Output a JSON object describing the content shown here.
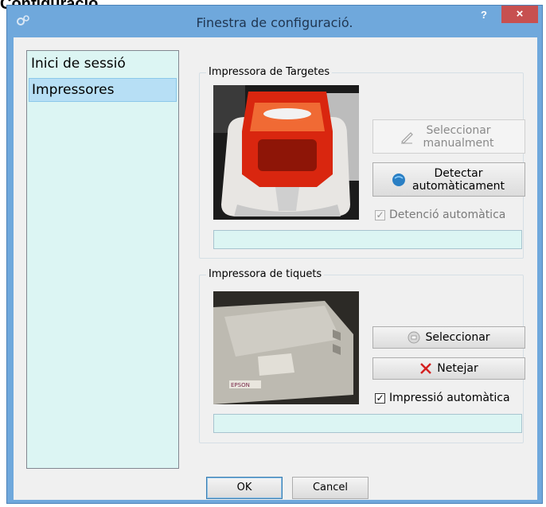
{
  "background_heading": "Configuració",
  "window": {
    "title": "Finestra de configuració.",
    "help_label": "?",
    "close_label": "×"
  },
  "sidebar": {
    "items": [
      {
        "label": "Inici de sessió",
        "selected": false
      },
      {
        "label": "Impressores",
        "selected": true
      }
    ]
  },
  "card_printer": {
    "legend": "Impressora de Targetes",
    "select_manual_label": "Seleccionar manualment",
    "select_manual_enabled": false,
    "detect_label": "Detectar automàticament",
    "auto_detect_label": "Detenció automàtica",
    "auto_detect_checked": true,
    "auto_detect_enabled": false,
    "status_value": ""
  },
  "ticket_printer": {
    "legend": "Impressora de tiquets",
    "select_label": "Seleccionar",
    "clear_label": "Netejar",
    "auto_print_label": "Impressió automàtica",
    "auto_print_checked": true,
    "status_value": ""
  },
  "footer": {
    "ok_label": "OK",
    "cancel_label": "Cancel"
  },
  "colors": {
    "title_bar": "#6fa8dc",
    "close_button": "#c75050",
    "list_background": "#dcf5f3",
    "selected_item": "#b7dff5"
  }
}
